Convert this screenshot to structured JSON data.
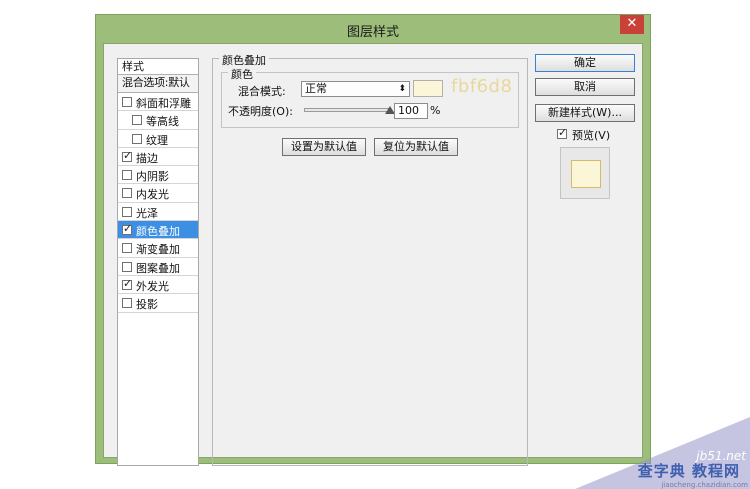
{
  "window": {
    "title": "图层样式",
    "close_glyph": "✕"
  },
  "styles": {
    "header": "样式",
    "blend_options": "混合选项:默认",
    "items": [
      {
        "label": "斜面和浮雕",
        "checked": false,
        "indent": false
      },
      {
        "label": "等高线",
        "checked": false,
        "indent": true
      },
      {
        "label": "纹理",
        "checked": false,
        "indent": true
      },
      {
        "label": "描边",
        "checked": true,
        "indent": false
      },
      {
        "label": "内阴影",
        "checked": false,
        "indent": false
      },
      {
        "label": "内发光",
        "checked": false,
        "indent": false
      },
      {
        "label": "光泽",
        "checked": false,
        "indent": false
      },
      {
        "label": "颜色叠加",
        "checked": true,
        "indent": false,
        "active": true
      },
      {
        "label": "渐变叠加",
        "checked": false,
        "indent": false
      },
      {
        "label": "图案叠加",
        "checked": false,
        "indent": false
      },
      {
        "label": "外发光",
        "checked": true,
        "indent": false
      },
      {
        "label": "投影",
        "checked": false,
        "indent": false
      }
    ]
  },
  "panel": {
    "title": "颜色叠加",
    "group_title": "颜色",
    "blend_mode_label": "混合模式:",
    "blend_mode_value": "正常",
    "color_hex": "fbf6d8",
    "swatch_color": "#fbf6d8",
    "opacity_label": "不透明度(O):",
    "opacity_value": "100",
    "opacity_unit": "%",
    "opacity_fraction": 1.0,
    "set_default_button": "设置为默认值",
    "reset_default_button": "复位为默认值"
  },
  "actions": {
    "ok": "确定",
    "cancel": "取消",
    "new_style": "新建样式(W)...",
    "preview_label": "预览(V)",
    "preview_checked": true
  },
  "watermark": {
    "site": "jb51.net",
    "brand": "查字典 教程网",
    "sub": "jiaocheng.chazidian.com"
  },
  "colors": {
    "frame": "#9cbe7a",
    "active_item": "#3d8fe3",
    "hex_text": "#e9d89a",
    "close": "#c9423a"
  }
}
